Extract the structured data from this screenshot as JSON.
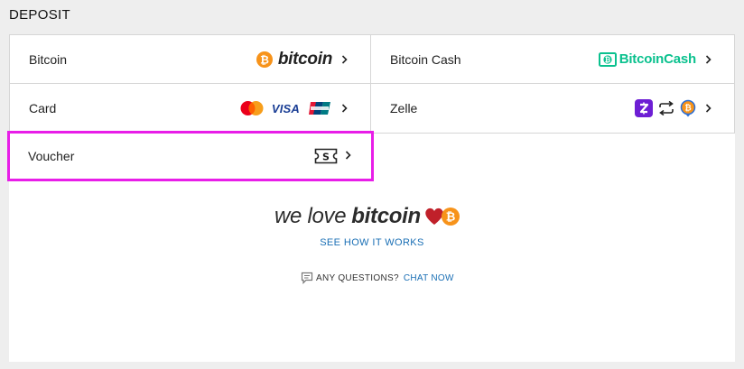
{
  "page": {
    "title": "DEPOSIT"
  },
  "methods": {
    "bitcoin": {
      "label": "Bitcoin",
      "logo_text": "bitcoin",
      "icon": "bitcoin-icon"
    },
    "bitcoin_cash": {
      "label": "Bitcoin Cash",
      "logo_text": "BitcoinCash",
      "icon": "bitcoin-cash-icon"
    },
    "card": {
      "label": "Card",
      "logos": [
        "mastercard-icon",
        "visa-icon",
        "unionpay-icon"
      ],
      "visa_text": "VISA"
    },
    "zelle": {
      "label": "Zelle",
      "logos": [
        "zelle-icon",
        "exchange-icon",
        "bitcoin-coin-icon"
      ]
    },
    "voucher": {
      "label": "Voucher",
      "icon": "voucher-icon"
    }
  },
  "promo": {
    "we_love": "we love",
    "bitcoin": "bitcoin",
    "see_how": "SEE HOW IT WORKS",
    "questions": "ANY QUESTIONS?",
    "chat": "CHAT NOW"
  },
  "colors": {
    "bitcoin_orange": "#f7931a",
    "bch_green": "#0ac18e",
    "highlight": "#e81ee8",
    "link_blue": "#1a6fb5",
    "heart_red": "#c0202a",
    "zelle_purple": "#6d1ed4"
  }
}
